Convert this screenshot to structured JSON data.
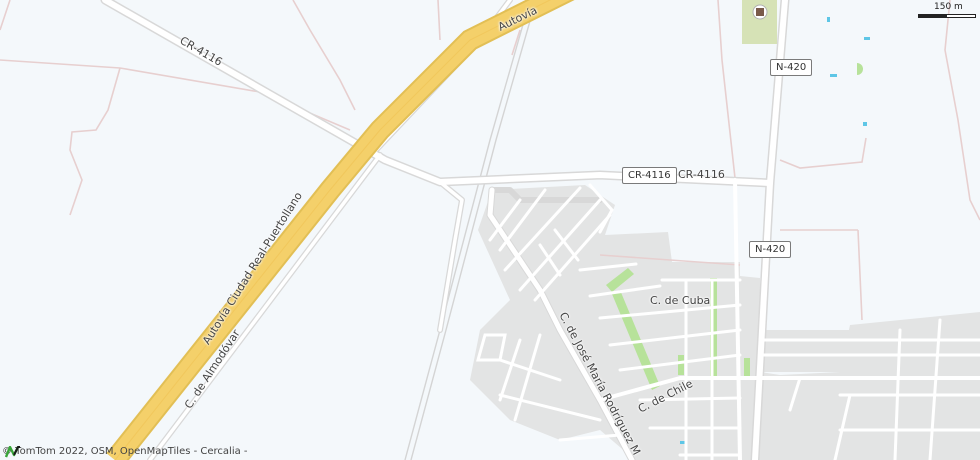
{
  "map": {
    "road_labels": {
      "autovia_top": "Autovía",
      "cr4116_west": "CR-4116",
      "cr4116_east": "CR-4116",
      "autovia_ciudad_real": "Autovía Ciudad Real-Puertollano",
      "almodovar": "C. de Almodóvar",
      "jose_maria": "C. de José María Rodríguez M",
      "cuba": "C. de Cuba",
      "chile": "C. de Chile"
    },
    "shields": {
      "cr4116": "CR-4116",
      "n420_north": "N-420",
      "n420_south": "N-420"
    },
    "scale": {
      "label": "150 m"
    },
    "attribution": "© TomTom 2022, OSM, OpenMapTiles - Cercalia -",
    "colors": {
      "background": "#f4f8fb",
      "motorway": "#f4d06a",
      "urban_area": "#e3e4e4",
      "park": "#b7e29a",
      "minor_road": "#ffffff",
      "road_casing": "#d8d8d8",
      "water": "#5ec6e6"
    }
  }
}
